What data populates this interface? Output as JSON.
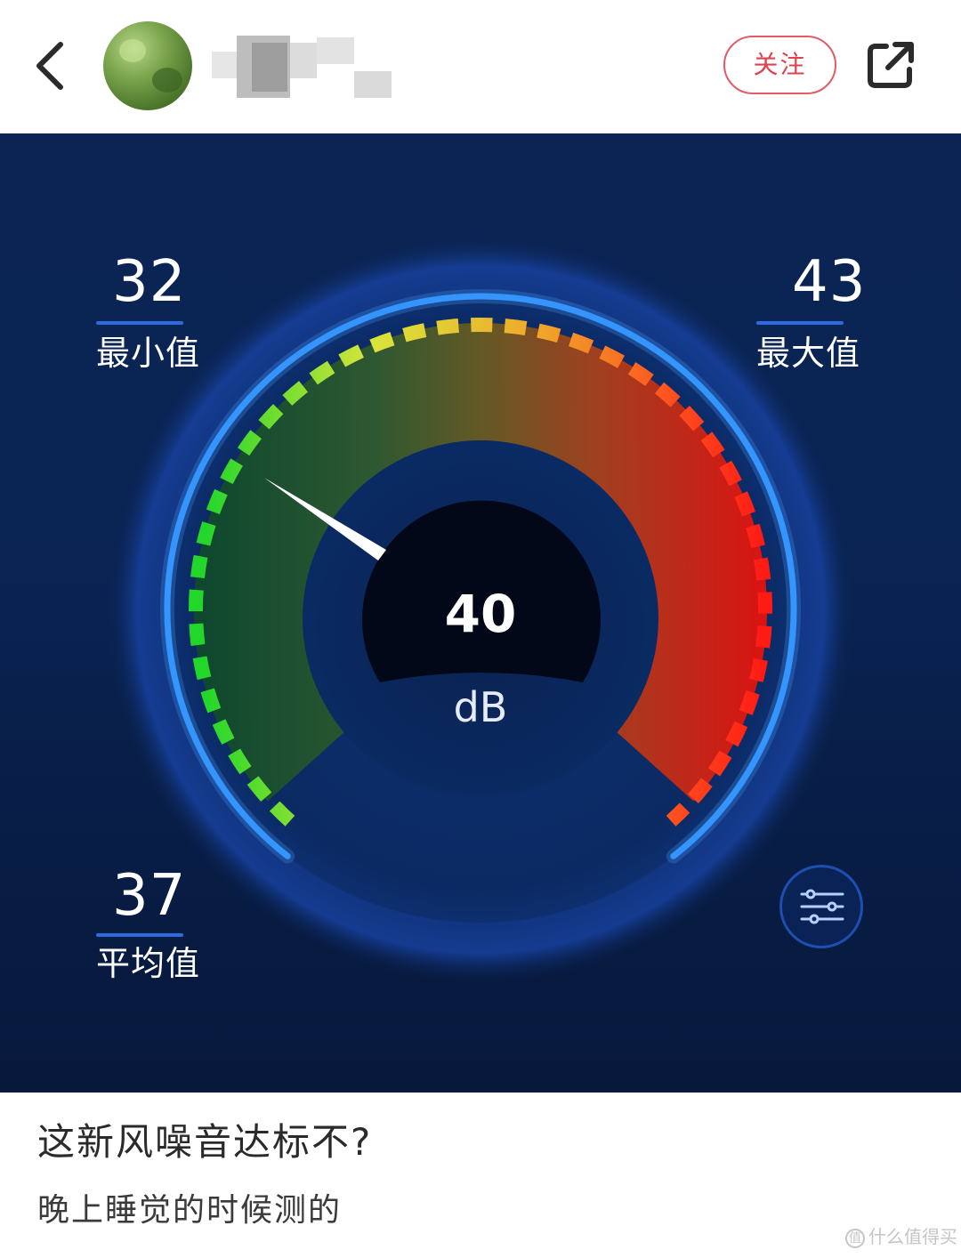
{
  "header": {
    "follow_label": "关注"
  },
  "meter": {
    "current_value": "40",
    "current_unit": "dB",
    "min": {
      "value": "32",
      "label": "最小值"
    },
    "max": {
      "value": "43",
      "label": "最大值"
    },
    "avg": {
      "value": "37",
      "label": "平均值"
    },
    "scale_colors": [
      "#22d72a",
      "#d9e53a",
      "#f0a62a",
      "#ff2a1e"
    ],
    "ring_color": "#2c8fff"
  },
  "post": {
    "title": "这新风噪音达标不?",
    "body": "晚上睡觉的时候测的"
  },
  "watermark": {
    "text": "什么值得买",
    "logo": "值"
  }
}
